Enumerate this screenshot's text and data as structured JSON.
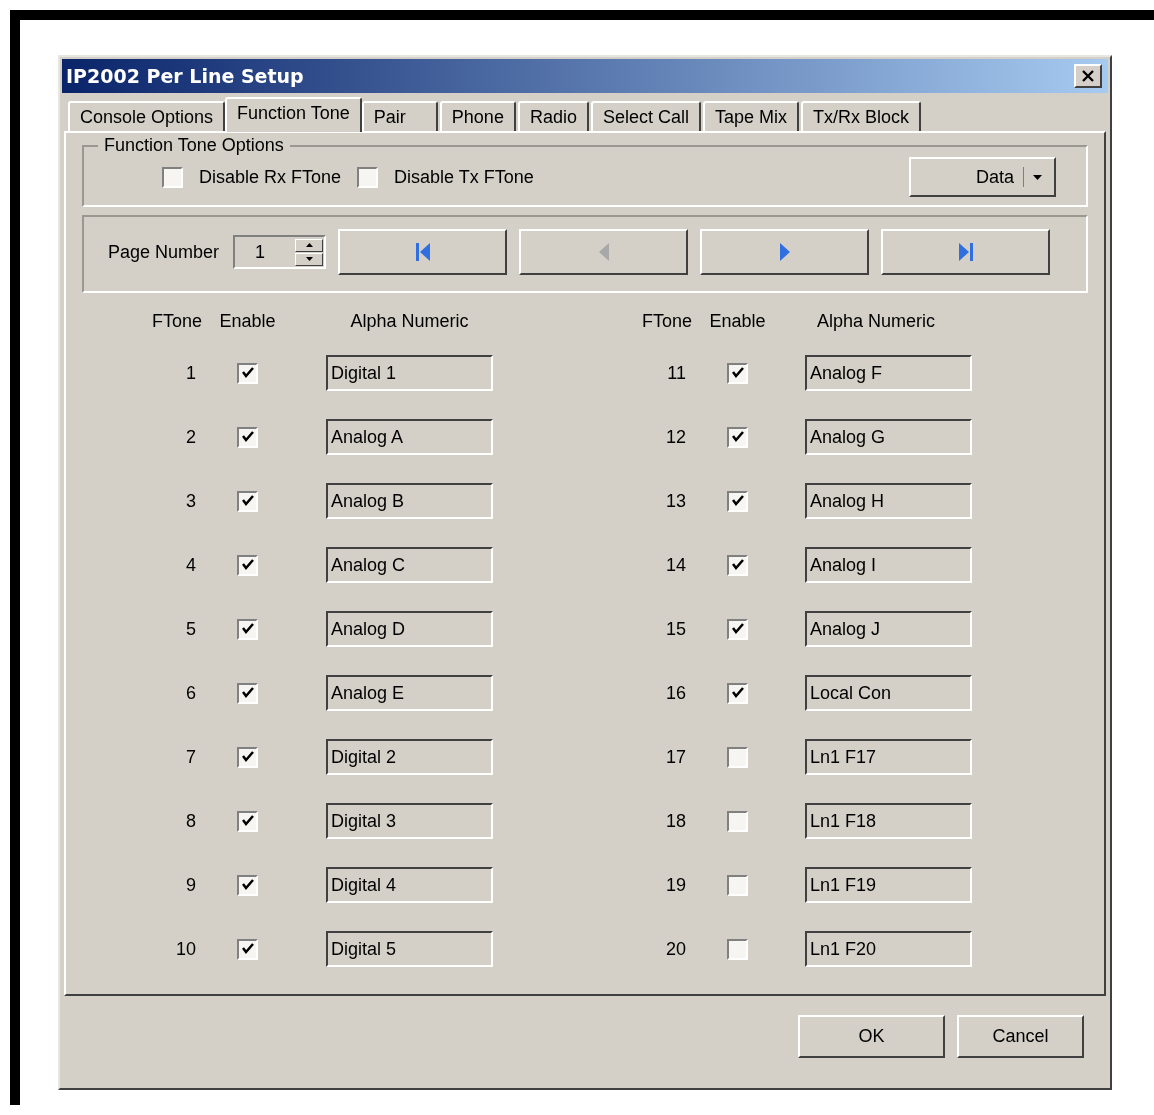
{
  "window": {
    "title": "IP2002 Per Line Setup"
  },
  "tabs": [
    {
      "label": "Console Options",
      "selected": false
    },
    {
      "label": "Function Tone",
      "selected": true
    },
    {
      "label": "Pair",
      "selected": false
    },
    {
      "label": "Phone",
      "selected": false
    },
    {
      "label": "Radio",
      "selected": false
    },
    {
      "label": "Select Call",
      "selected": false
    },
    {
      "label": "Tape Mix",
      "selected": false
    },
    {
      "label": "Tx/Rx Block",
      "selected": false
    }
  ],
  "options": {
    "title": "Function Tone Options",
    "checkboxes": [
      {
        "label": "Disable Rx FTone",
        "checked": false
      },
      {
        "label": "Disable Tx FTone",
        "checked": false
      }
    ],
    "data_button": {
      "label": "Data"
    }
  },
  "pager": {
    "label": "Page Number",
    "value": "1",
    "nav_buttons": [
      {
        "kind": "first",
        "disabled": false
      },
      {
        "kind": "prev",
        "disabled": true
      },
      {
        "kind": "next",
        "disabled": false
      },
      {
        "kind": "last",
        "disabled": false
      }
    ]
  },
  "columns": [
    {
      "headers": [
        "FTone",
        "Enable",
        "Alpha Numeric"
      ],
      "rows": [
        {
          "ftone": "1",
          "enabled": true,
          "alpha": "Digital 1"
        },
        {
          "ftone": "2",
          "enabled": true,
          "alpha": "Analog A"
        },
        {
          "ftone": "3",
          "enabled": true,
          "alpha": "Analog B"
        },
        {
          "ftone": "4",
          "enabled": true,
          "alpha": "Analog C"
        },
        {
          "ftone": "5",
          "enabled": true,
          "alpha": "Analog D"
        },
        {
          "ftone": "6",
          "enabled": true,
          "alpha": "Analog E"
        },
        {
          "ftone": "7",
          "enabled": true,
          "alpha": "Digital 2"
        },
        {
          "ftone": "8",
          "enabled": true,
          "alpha": "Digital 3"
        },
        {
          "ftone": "9",
          "enabled": true,
          "alpha": "Digital 4"
        },
        {
          "ftone": "10",
          "enabled": true,
          "alpha": "Digital 5"
        }
      ]
    },
    {
      "headers": [
        "FTone",
        "Enable",
        "Alpha Numeric"
      ],
      "rows": [
        {
          "ftone": "11",
          "enabled": true,
          "alpha": "Analog F"
        },
        {
          "ftone": "12",
          "enabled": true,
          "alpha": "Analog G"
        },
        {
          "ftone": "13",
          "enabled": true,
          "alpha": "Analog H"
        },
        {
          "ftone": "14",
          "enabled": true,
          "alpha": "Analog I"
        },
        {
          "ftone": "15",
          "enabled": true,
          "alpha": "Analog J"
        },
        {
          "ftone": "16",
          "enabled": true,
          "alpha": "Local Con"
        },
        {
          "ftone": "17",
          "enabled": false,
          "alpha": "Ln1 F17"
        },
        {
          "ftone": "18",
          "enabled": false,
          "alpha": "Ln1 F18"
        },
        {
          "ftone": "19",
          "enabled": false,
          "alpha": "Ln1 F19"
        },
        {
          "ftone": "20",
          "enabled": false,
          "alpha": "Ln1 F20"
        }
      ]
    }
  ],
  "buttons": [
    "OK",
    "Cancel"
  ]
}
